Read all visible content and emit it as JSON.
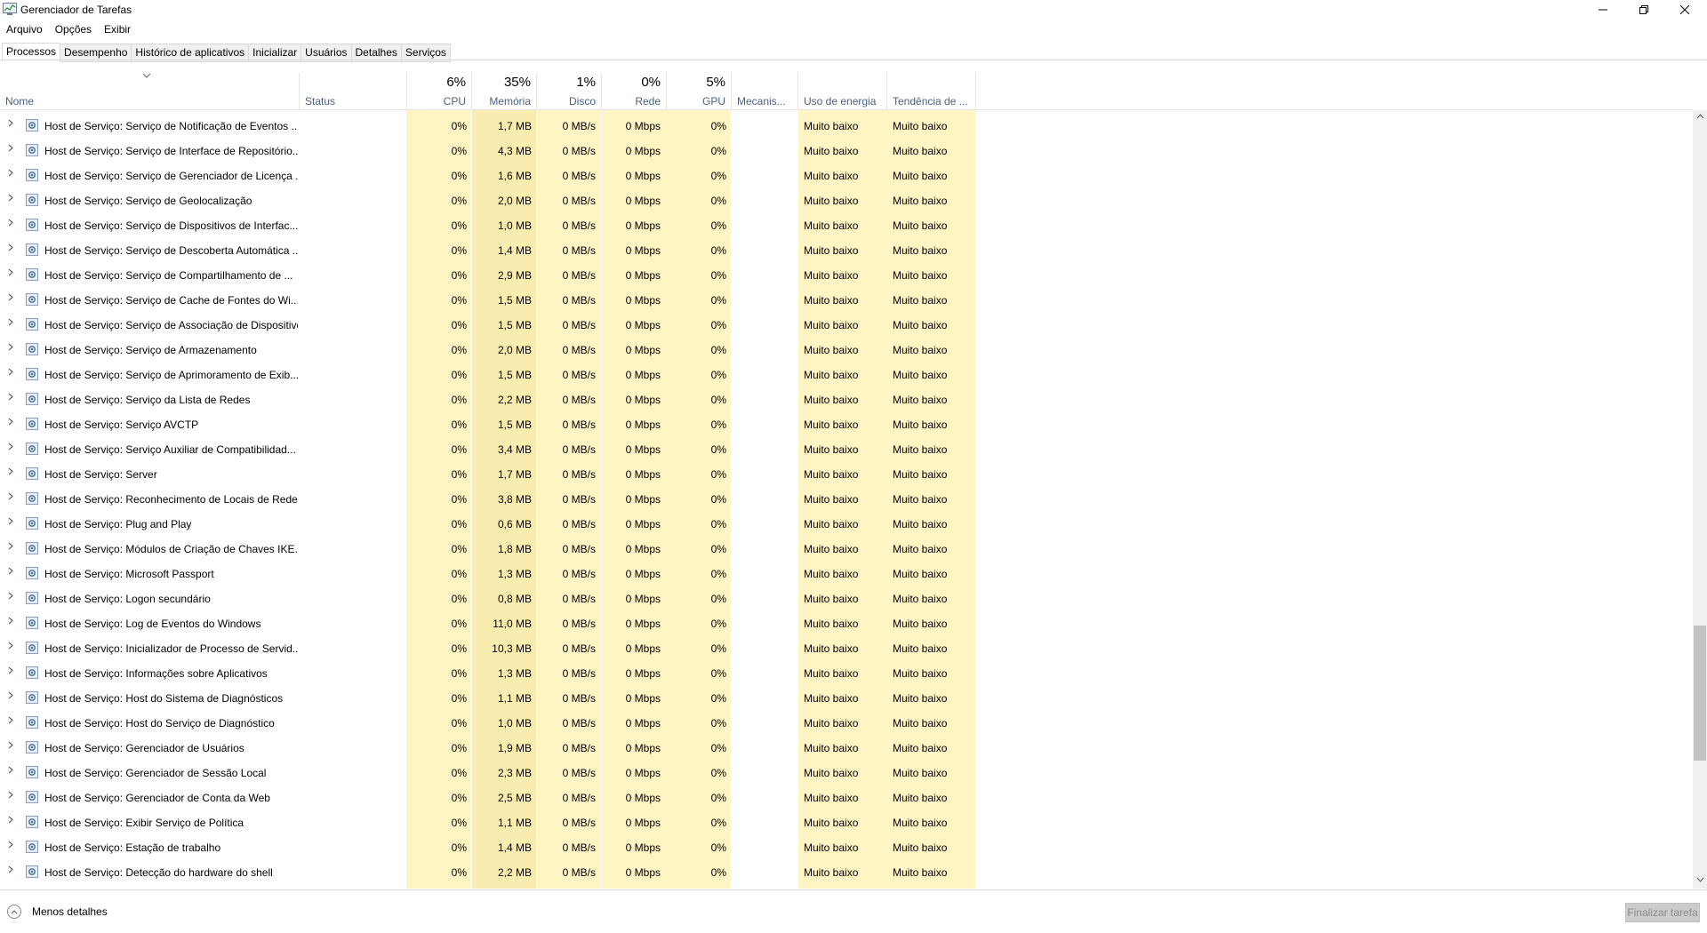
{
  "window": {
    "title": "Gerenciador de Tarefas"
  },
  "menu": [
    {
      "label": "Arquivo"
    },
    {
      "label": "Opções"
    },
    {
      "label": "Exibir"
    }
  ],
  "tabs": [
    {
      "label": "Processos"
    },
    {
      "label": "Desempenho"
    },
    {
      "label": "Histórico de aplicativos"
    },
    {
      "label": "Inicializar"
    },
    {
      "label": "Usuários"
    },
    {
      "label": "Detalhes"
    },
    {
      "label": "Serviços"
    }
  ],
  "columns": {
    "name": "Nome",
    "status": "Status",
    "cpu": {
      "pct": "6%",
      "label": "CPU"
    },
    "memory": {
      "pct": "35%",
      "label": "Memória"
    },
    "disk": {
      "pct": "1%",
      "label": "Disco"
    },
    "network": {
      "pct": "0%",
      "label": "Rede"
    },
    "gpu": {
      "pct": "5%",
      "label": "GPU"
    },
    "gpu_engine": "Mecanis...",
    "power": "Uso de energia",
    "power_trend": "Tendência de ..."
  },
  "rows": [
    {
      "name": "Host de Serviço: Serviço de Notificação de Eventos ...",
      "cpu": "0%",
      "mem": "1,7 MB",
      "disk": "0 MB/s",
      "net": "0 Mbps",
      "gpu": "0%",
      "power": "Muito baixo",
      "trend": "Muito baixo"
    },
    {
      "name": "Host de Serviço: Serviço de Interface de Repositório...",
      "cpu": "0%",
      "mem": "4,3 MB",
      "disk": "0 MB/s",
      "net": "0 Mbps",
      "gpu": "0%",
      "power": "Muito baixo",
      "trend": "Muito baixo"
    },
    {
      "name": "Host de Serviço: Serviço de Gerenciador de Licença ...",
      "cpu": "0%",
      "mem": "1,6 MB",
      "disk": "0 MB/s",
      "net": "0 Mbps",
      "gpu": "0%",
      "power": "Muito baixo",
      "trend": "Muito baixo"
    },
    {
      "name": "Host de Serviço: Serviço de Geolocalização",
      "cpu": "0%",
      "mem": "2,0 MB",
      "disk": "0 MB/s",
      "net": "0 Mbps",
      "gpu": "0%",
      "power": "Muito baixo",
      "trend": "Muito baixo"
    },
    {
      "name": "Host de Serviço: Serviço de Dispositivos de Interfac...",
      "cpu": "0%",
      "mem": "1,0 MB",
      "disk": "0 MB/s",
      "net": "0 Mbps",
      "gpu": "0%",
      "power": "Muito baixo",
      "trend": "Muito baixo"
    },
    {
      "name": "Host de Serviço: Serviço de Descoberta Automática ...",
      "cpu": "0%",
      "mem": "1,4 MB",
      "disk": "0 MB/s",
      "net": "0 Mbps",
      "gpu": "0%",
      "power": "Muito baixo",
      "trend": "Muito baixo"
    },
    {
      "name": "Host de Serviço: Serviço de Compartilhamento de ...",
      "cpu": "0%",
      "mem": "2,9 MB",
      "disk": "0 MB/s",
      "net": "0 Mbps",
      "gpu": "0%",
      "power": "Muito baixo",
      "trend": "Muito baixo"
    },
    {
      "name": "Host de Serviço: Serviço de Cache de Fontes do Wi...",
      "cpu": "0%",
      "mem": "1,5 MB",
      "disk": "0 MB/s",
      "net": "0 Mbps",
      "gpu": "0%",
      "power": "Muito baixo",
      "trend": "Muito baixo"
    },
    {
      "name": "Host de Serviço: Serviço de Associação de Dispositivo",
      "cpu": "0%",
      "mem": "1,5 MB",
      "disk": "0 MB/s",
      "net": "0 Mbps",
      "gpu": "0%",
      "power": "Muito baixo",
      "trend": "Muito baixo"
    },
    {
      "name": "Host de Serviço: Serviço de Armazenamento",
      "cpu": "0%",
      "mem": "2,0 MB",
      "disk": "0 MB/s",
      "net": "0 Mbps",
      "gpu": "0%",
      "power": "Muito baixo",
      "trend": "Muito baixo"
    },
    {
      "name": "Host de Serviço: Serviço de Aprimoramento de Exib...",
      "cpu": "0%",
      "mem": "1,5 MB",
      "disk": "0 MB/s",
      "net": "0 Mbps",
      "gpu": "0%",
      "power": "Muito baixo",
      "trend": "Muito baixo"
    },
    {
      "name": "Host de Serviço: Serviço da Lista de Redes",
      "cpu": "0%",
      "mem": "2,2 MB",
      "disk": "0 MB/s",
      "net": "0 Mbps",
      "gpu": "0%",
      "power": "Muito baixo",
      "trend": "Muito baixo"
    },
    {
      "name": "Host de Serviço: Serviço AVCTP",
      "cpu": "0%",
      "mem": "1,5 MB",
      "disk": "0 MB/s",
      "net": "0 Mbps",
      "gpu": "0%",
      "power": "Muito baixo",
      "trend": "Muito baixo"
    },
    {
      "name": "Host de Serviço: Serviço Auxiliar de Compatibilidad...",
      "cpu": "0%",
      "mem": "3,4 MB",
      "disk": "0 MB/s",
      "net": "0 Mbps",
      "gpu": "0%",
      "power": "Muito baixo",
      "trend": "Muito baixo"
    },
    {
      "name": "Host de Serviço: Server",
      "cpu": "0%",
      "mem": "1,7 MB",
      "disk": "0 MB/s",
      "net": "0 Mbps",
      "gpu": "0%",
      "power": "Muito baixo",
      "trend": "Muito baixo"
    },
    {
      "name": "Host de Serviço: Reconhecimento de Locais de Rede",
      "cpu": "0%",
      "mem": "3,8 MB",
      "disk": "0 MB/s",
      "net": "0 Mbps",
      "gpu": "0%",
      "power": "Muito baixo",
      "trend": "Muito baixo"
    },
    {
      "name": "Host de Serviço: Plug and Play",
      "cpu": "0%",
      "mem": "0,6 MB",
      "disk": "0 MB/s",
      "net": "0 Mbps",
      "gpu": "0%",
      "power": "Muito baixo",
      "trend": "Muito baixo"
    },
    {
      "name": "Host de Serviço: Módulos de Criação de Chaves IKE...",
      "cpu": "0%",
      "mem": "1,8 MB",
      "disk": "0 MB/s",
      "net": "0 Mbps",
      "gpu": "0%",
      "power": "Muito baixo",
      "trend": "Muito baixo"
    },
    {
      "name": "Host de Serviço: Microsoft Passport",
      "cpu": "0%",
      "mem": "1,3 MB",
      "disk": "0 MB/s",
      "net": "0 Mbps",
      "gpu": "0%",
      "power": "Muito baixo",
      "trend": "Muito baixo"
    },
    {
      "name": "Host de Serviço: Logon secundário",
      "cpu": "0%",
      "mem": "0,8 MB",
      "disk": "0 MB/s",
      "net": "0 Mbps",
      "gpu": "0%",
      "power": "Muito baixo",
      "trend": "Muito baixo"
    },
    {
      "name": "Host de Serviço: Log de Eventos do Windows",
      "cpu": "0%",
      "mem": "11,0 MB",
      "disk": "0 MB/s",
      "net": "0 Mbps",
      "gpu": "0%",
      "power": "Muito baixo",
      "trend": "Muito baixo"
    },
    {
      "name": "Host de Serviço: Inicializador de Processo de Servid...",
      "cpu": "0%",
      "mem": "10,3 MB",
      "disk": "0 MB/s",
      "net": "0 Mbps",
      "gpu": "0%",
      "power": "Muito baixo",
      "trend": "Muito baixo"
    },
    {
      "name": "Host de Serviço: Informações sobre Aplicativos",
      "cpu": "0%",
      "mem": "1,3 MB",
      "disk": "0 MB/s",
      "net": "0 Mbps",
      "gpu": "0%",
      "power": "Muito baixo",
      "trend": "Muito baixo"
    },
    {
      "name": "Host de Serviço: Host do Sistema de Diagnósticos",
      "cpu": "0%",
      "mem": "1,1 MB",
      "disk": "0 MB/s",
      "net": "0 Mbps",
      "gpu": "0%",
      "power": "Muito baixo",
      "trend": "Muito baixo"
    },
    {
      "name": "Host de Serviço: Host do Serviço de Diagnóstico",
      "cpu": "0%",
      "mem": "1,0 MB",
      "disk": "0 MB/s",
      "net": "0 Mbps",
      "gpu": "0%",
      "power": "Muito baixo",
      "trend": "Muito baixo"
    },
    {
      "name": "Host de Serviço: Gerenciador de Usuários",
      "cpu": "0%",
      "mem": "1,9 MB",
      "disk": "0 MB/s",
      "net": "0 Mbps",
      "gpu": "0%",
      "power": "Muito baixo",
      "trend": "Muito baixo"
    },
    {
      "name": "Host de Serviço: Gerenciador de Sessão Local",
      "cpu": "0%",
      "mem": "2,3 MB",
      "disk": "0 MB/s",
      "net": "0 Mbps",
      "gpu": "0%",
      "power": "Muito baixo",
      "trend": "Muito baixo"
    },
    {
      "name": "Host de Serviço: Gerenciador de Conta da Web",
      "cpu": "0%",
      "mem": "2,5 MB",
      "disk": "0 MB/s",
      "net": "0 Mbps",
      "gpu": "0%",
      "power": "Muito baixo",
      "trend": "Muito baixo"
    },
    {
      "name": "Host de Serviço: Exibir Serviço de Política",
      "cpu": "0%",
      "mem": "1,1 MB",
      "disk": "0 MB/s",
      "net": "0 Mbps",
      "gpu": "0%",
      "power": "Muito baixo",
      "trend": "Muito baixo"
    },
    {
      "name": "Host de Serviço: Estação de trabalho",
      "cpu": "0%",
      "mem": "1,4 MB",
      "disk": "0 MB/s",
      "net": "0 Mbps",
      "gpu": "0%",
      "power": "Muito baixo",
      "trend": "Muito baixo"
    },
    {
      "name": "Host de Serviço: Detecção do hardware do shell",
      "cpu": "0%",
      "mem": "2,2 MB",
      "disk": "0 MB/s",
      "net": "0 Mbps",
      "gpu": "0%",
      "power": "Muito baixo",
      "trend": "Muito baixo"
    }
  ],
  "footer": {
    "less_details": "Menos detalhes",
    "end_task": "Finalizar tarefa"
  },
  "colors": {
    "heat_light": "#fff4c4",
    "heat_mem": "#f9ecb0",
    "header_text": "#4d6082"
  },
  "icons": {
    "row": "gear-icon",
    "expand": "chevron-right-icon",
    "sort": "chevron-down-icon",
    "less_details": "chevron-up-icon"
  }
}
